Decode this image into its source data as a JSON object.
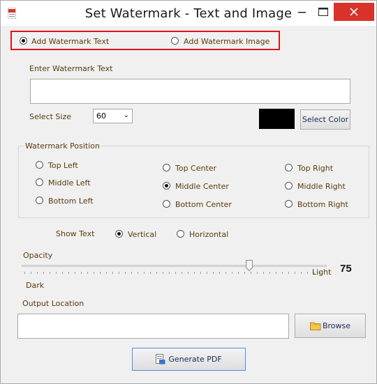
{
  "window": {
    "title": "Set Watermark  - Text and Image"
  },
  "mode": {
    "text_label": "Add Watermark Text",
    "image_label": "Add Watermark Image",
    "selected": "text"
  },
  "watermark_text": {
    "label": "Enter Watermark Text",
    "value": ""
  },
  "size": {
    "label": "Select Size",
    "value": "60"
  },
  "color": {
    "swatch": "#000000",
    "button_label": "Select Color"
  },
  "position": {
    "title": "Watermark Position",
    "options": [
      "Top Left",
      "Top Center",
      "Top Right",
      "Middle Left",
      "Middle Center",
      "Middle Right",
      "Bottom Left",
      "Bottom Center",
      "Bottom Right"
    ],
    "selected": "Middle Center"
  },
  "show_text": {
    "label": "Show Text",
    "vertical": "Vertical",
    "horizontal": "Horizontal",
    "selected": "Vertical"
  },
  "opacity": {
    "label": "Opacity",
    "light": "Light",
    "dark": "Dark",
    "value": "75"
  },
  "output": {
    "label": "Output Location",
    "value": "",
    "browse_label": "Browse"
  },
  "generate": {
    "label": "Generate PDF"
  }
}
